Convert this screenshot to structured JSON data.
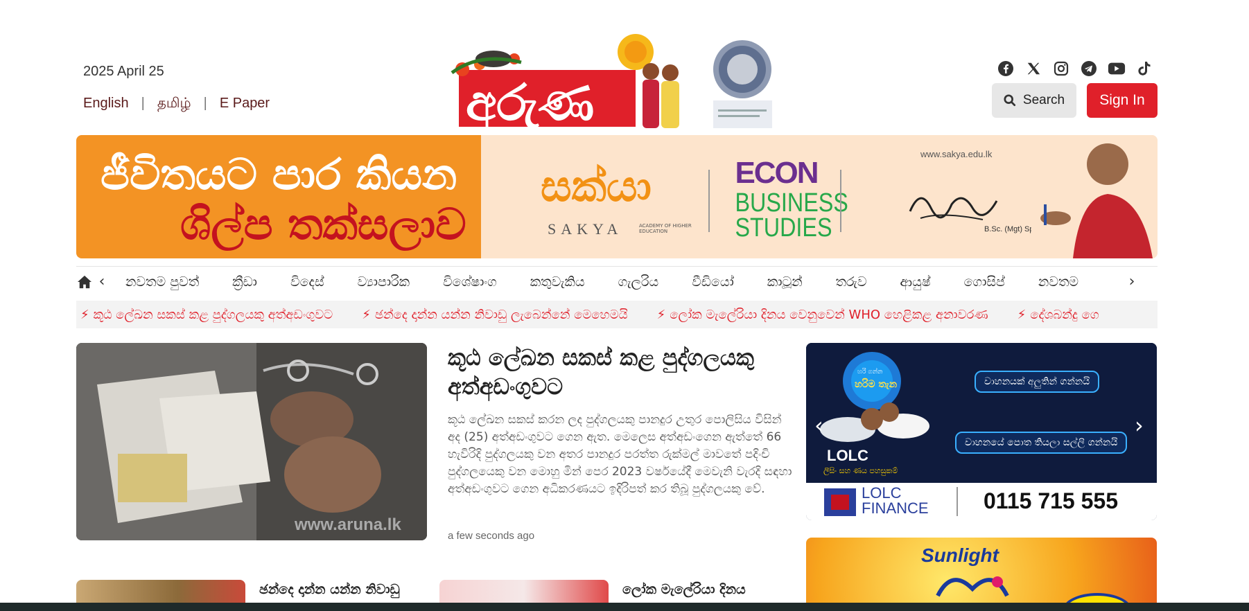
{
  "header": {
    "date": "2025 April 25",
    "languages": [
      "English",
      "தமிழ்",
      "E Paper"
    ],
    "logo_text": "අරුණ",
    "search_label": "Search",
    "signin_label": "Sign In",
    "socials": [
      "facebook-icon",
      "x-icon",
      "instagram-icon",
      "telegram-icon",
      "youtube-icon",
      "tiktok-icon"
    ]
  },
  "banner": {
    "line1": "ජීවිතයට පාර කියන",
    "line2": "ශිල්ප තක්සලාව",
    "brand": "සක්යා",
    "brand_latin": "SAKYA",
    "brand_sub": "ACADEMY OF HIGHER EDUCATION",
    "econ": "ECON",
    "econ_sub1": "BUSINESS",
    "econ_sub2": "STUDIES",
    "url": "www.sakya.edu.lk",
    "degree": "B.Sc. (Mgt) Sp"
  },
  "nav": {
    "items": [
      "නවතම පුවත්",
      "ක්‍රීඩා",
      "විදෙස්",
      "ව්‍යාපාරික",
      "විශේෂාංග",
      "කතුවැකිය",
      "ගැලරිය",
      "වීඩියෝ",
      "කාටූන්",
      "තරුව",
      "ආයුෂ්",
      "ගොසිප්",
      "නවතම"
    ]
  },
  "ticker": {
    "items": [
      "කූඨ ලේඛන සකස් කළ පුද්ගලයකු අත්අඩංගුවට",
      "ඡන්දෙ දාන්න යන්න නිවාඩු ලැබෙන්නේ මෙහෙමයි",
      "ලෝක මැලේරියා දිනය වෙනුවෙන් WHO හෙළිකළ අනාවරණ",
      "දේශබන්දු ගෙ"
    ]
  },
  "main_article": {
    "headline": "කූඨ ලේඛන සකස් කළ පුද්ගලයකු අත්අඩංගුවට",
    "summary": "කූඨ ලේඛන සකස් කරන ලද පුද්ගලයකු පානදුර උතුර පොලිසිය විසින් අද (25) අත්අඩංගුවට ගෙන ඇත. මෙලෙස අත්අඩංගෙන ඇත්තේ 66 හැවිරිදි පුද්ගලයකු වන අතර පානදුර පරත්ත රුක්මල් මාවතේ පදිංචි පුද්ගලයෙකු වන මොහු මින් පෙර 2023 වර්ෂයේදී මෙවැනි වැරදි සඳහා අත්අඩංගුවට ගෙන අධිකරණයට ඉදිරිපත් කර තිබූ පුද්ගලයකු වේ.",
    "time": "a few seconds ago",
    "watermark": "www.aruna.lk"
  },
  "ad1": {
    "pill1": "වාහනයක් අලුතින් ගන්නයි",
    "pill2": "වාහනයේ පොත තියලා සල්ලි ගන්නයි",
    "brand": "LOLC",
    "brand_tag": "ලීසිං සහ ණය පහසුකම්",
    "badge_top": "හරි ගන්න",
    "badge_main": "හරිම තැන",
    "finance": "LOLC FINANCE",
    "phone": "0115 715 555"
  },
  "ad2": {
    "brand": "Sunlight"
  },
  "cards": [
    {
      "title": "ඡන්දෙ දාන්න යන්න නිවාඩු"
    },
    {
      "title": "ලෝක මැලේරියා දිනය"
    }
  ]
}
